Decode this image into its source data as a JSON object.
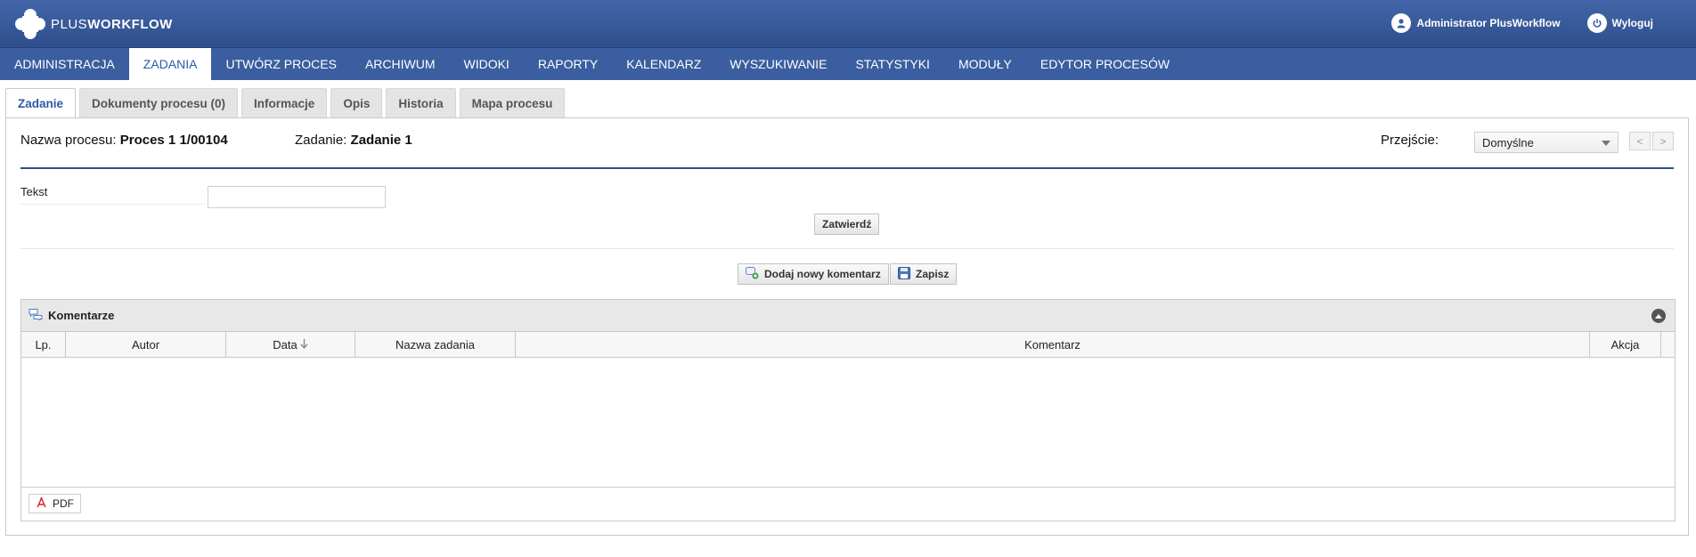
{
  "header": {
    "logo_text_plus": "PLUS",
    "logo_text_workflow": "WORKFLOW",
    "user_name": "Administrator PlusWorkflow",
    "logout_label": "Wyloguj"
  },
  "nav": {
    "items": [
      {
        "label": "ADMINISTRACJA"
      },
      {
        "label": "ZADANIA"
      },
      {
        "label": "UTWÓRZ PROCES"
      },
      {
        "label": "ARCHIWUM"
      },
      {
        "label": "WIDOKI"
      },
      {
        "label": "RAPORTY"
      },
      {
        "label": "KALENDARZ"
      },
      {
        "label": "WYSZUKIWANIE"
      },
      {
        "label": "STATYSTYKI"
      },
      {
        "label": "MODUŁY"
      },
      {
        "label": "EDYTOR PROCESÓW"
      }
    ],
    "active": "ZADANIA"
  },
  "tabs": [
    {
      "label": "Zadanie"
    },
    {
      "label": "Dokumenty procesu (0)"
    },
    {
      "label": "Informacje"
    },
    {
      "label": "Opis"
    },
    {
      "label": "Historia"
    },
    {
      "label": "Mapa procesu"
    }
  ],
  "task": {
    "process_label": "Nazwa procesu:",
    "process_value": "Proces 1 1/00104",
    "task_label": "Zadanie:",
    "task_value": "Zadanie 1",
    "transition_label": "Przejście:",
    "transition_value": "Domyślne",
    "prev_label": "<",
    "next_label": ">"
  },
  "form": {
    "field_label": "Tekst",
    "field_value": "",
    "submit_label": "Zatwierdź"
  },
  "actions": {
    "add_comment_label": "Dodaj nowy komentarz",
    "save_label": "Zapisz"
  },
  "comments": {
    "title": "Komentarze",
    "columns": [
      "Lp.",
      "Autor",
      "Data",
      "Nazwa zadania",
      "Komentarz",
      "Akcja"
    ],
    "rows": [],
    "pdf_label": "PDF"
  },
  "colors": {
    "header_bg": "#3a5ea0",
    "accent": "#2b5aa8"
  }
}
